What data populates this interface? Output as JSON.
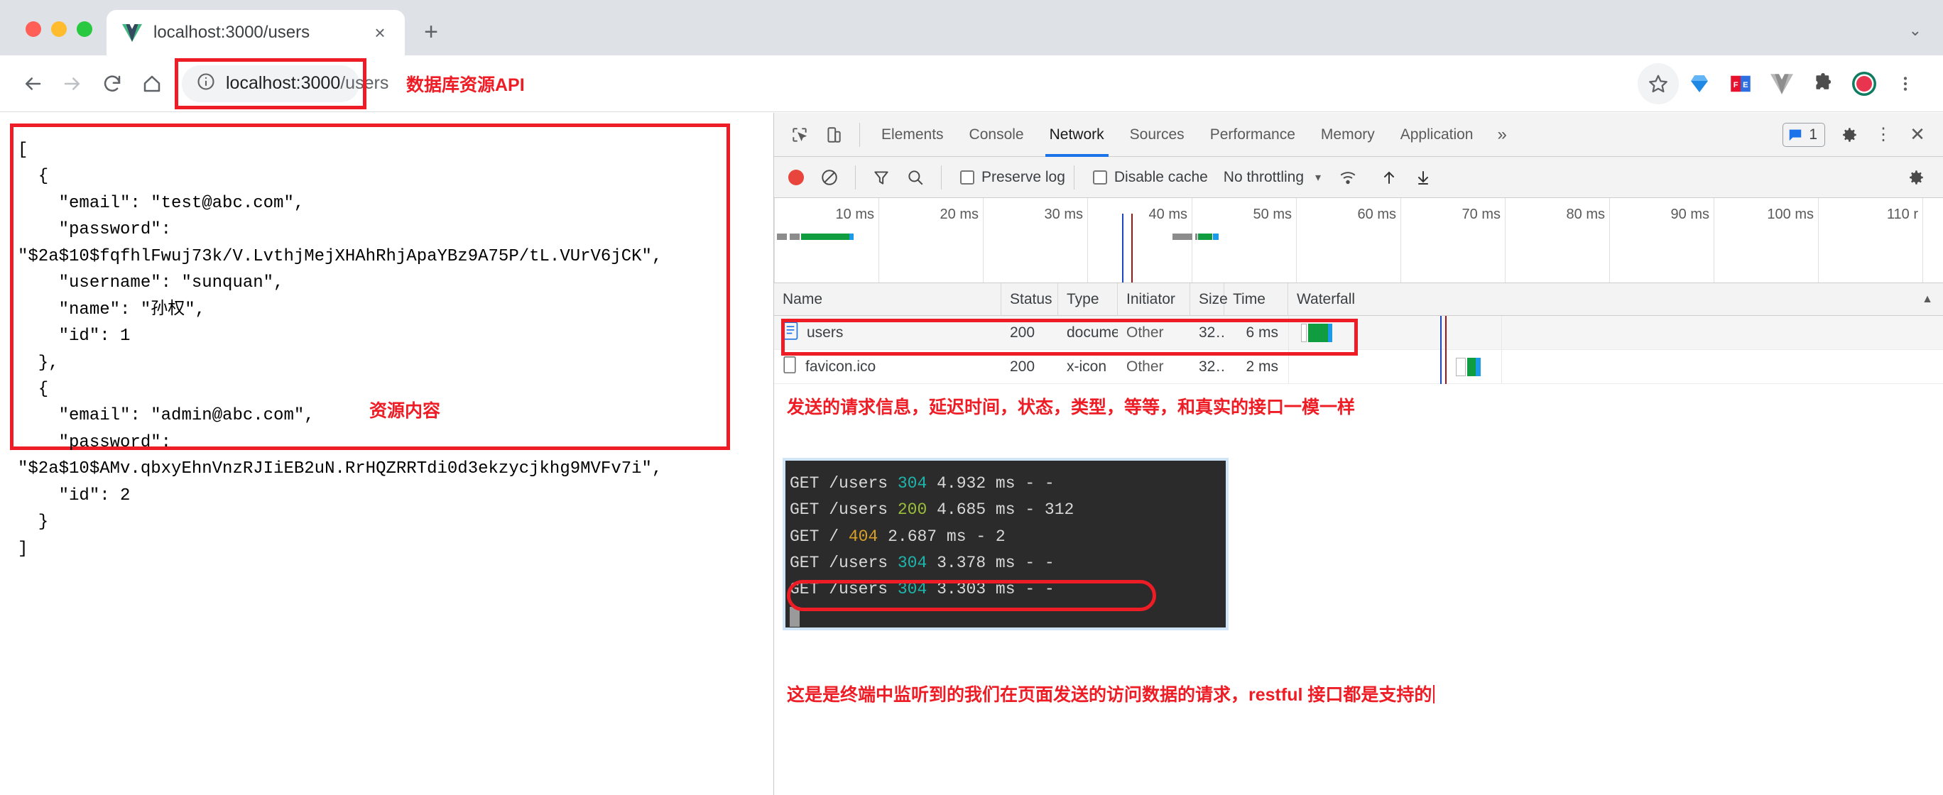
{
  "browser": {
    "tab": {
      "title": "localhost:3000/users",
      "favicon": "vue-logo-icon",
      "close": "×"
    },
    "newtab_label": "+",
    "tabstrip_chevron": "⌄",
    "nav": {
      "back": "←",
      "forward": "→",
      "reload": "↻",
      "home": "⌂"
    },
    "url": {
      "scheme_icon": "info-icon",
      "value": "localhost:3000/users",
      "host": "localhost:3000",
      "path": "/users"
    },
    "annotation_url": "数据库资源API",
    "extensions": [
      {
        "name": "bookmark-star-icon",
        "glyph": "☆"
      },
      {
        "name": "diamond-extension-icon",
        "glyph": "◆"
      },
      {
        "name": "fe-extension-icon",
        "glyph": "FE"
      },
      {
        "name": "vue-devtools-icon",
        "glyph": "V"
      },
      {
        "name": "puzzle-extensions-icon",
        "glyph": "❖"
      },
      {
        "name": "watermelon-extension-icon",
        "glyph": "●"
      },
      {
        "name": "chrome-menu-icon",
        "glyph": "⋮"
      }
    ]
  },
  "page": {
    "json_body": "[\n  {\n    \"email\": \"test@abc.com\",\n    \"password\":\n\"$2a$10$fqfhlFwuj73k/V.LvthjMejXHAhRhjApaYBz9A75P/tL.VUrV6jCK\",\n    \"username\": \"sunquan\",\n    \"name\": \"孙权\",\n    \"id\": 1\n  },\n  {\n    \"email\": \"admin@abc.com\",\n    \"password\":\n\"$2a$10$AMv.qbxyEhnVnzRJIiEB2uN.RrHQZRRTdi0d3ekzycjkhg9MVFv7i\",\n    \"id\": 2\n  }\n]",
    "annotation_resource": "资源内容"
  },
  "devtools": {
    "tabs": [
      {
        "label": "Elements",
        "active": false
      },
      {
        "label": "Console",
        "active": false
      },
      {
        "label": "Network",
        "active": true
      },
      {
        "label": "Sources",
        "active": false
      },
      {
        "label": "Performance",
        "active": false
      },
      {
        "label": "Memory",
        "active": false
      },
      {
        "label": "Application",
        "active": false
      }
    ],
    "more_tabs": "»",
    "message_count": "1",
    "settings_icon": "gear-icon",
    "kebab_icon": "⋮",
    "close_icon": "✕",
    "toolbar": {
      "record_label": "record-button",
      "clear_label": "clear-button",
      "filter_label": "filter-button",
      "search_label": "search-button",
      "preserve_log": "Preserve log",
      "disable_cache": "Disable cache",
      "throttling": "No throttling",
      "caret": "▾",
      "import_label": "import-har-button",
      "export_label": "export-har-button",
      "wifi_label": "network-conditions-icon"
    },
    "timeline_ticks": [
      "10 ms",
      "20 ms",
      "30 ms",
      "40 ms",
      "50 ms",
      "60 ms",
      "70 ms",
      "80 ms",
      "90 ms",
      "100 ms",
      "110 r"
    ],
    "table": {
      "columns": [
        "Name",
        "Status",
        "Type",
        "Initiator",
        "Size",
        "Time",
        "Waterfall"
      ],
      "sort_arrow": "▲",
      "rows": [
        {
          "icon": "document-icon",
          "name": "users",
          "status": "200",
          "type": "document",
          "initiator": "Other",
          "size": "32…",
          "time": "6 ms",
          "highlighted": true
        },
        {
          "icon": "file-icon",
          "name": "favicon.ico",
          "status": "200",
          "type": "x-icon",
          "initiator": "Other",
          "size": "32…",
          "time": "2 ms",
          "highlighted": false
        }
      ]
    },
    "annotation_network": "发送的请求信息，延迟时间，状态，类型，等等，和真实的接口一模一样",
    "terminal": {
      "lines": [
        {
          "method": "GET",
          "path": "/users",
          "status": "304",
          "status_class": "c-304",
          "rest": "4.932 ms - -"
        },
        {
          "method": "GET",
          "path": "/users",
          "status": "200",
          "status_class": "c-200",
          "rest": "4.685 ms - 312"
        },
        {
          "method": "GET",
          "path": "/",
          "status": "404",
          "status_class": "c-404",
          "rest": "2.687 ms - 2"
        },
        {
          "method": "GET",
          "path": "/users",
          "status": "304",
          "status_class": "c-304",
          "rest": "3.378 ms - -"
        },
        {
          "method": "GET",
          "path": "/users",
          "status": "304",
          "status_class": "c-304",
          "rest": "3.303 ms - -"
        }
      ]
    },
    "annotation_terminal": "这是是终端中监听到的我们在页面发送的访问数据的请求，restful 接口都是支持的"
  },
  "colors": {
    "annotation_red": "#ee1c25",
    "accent_blue": "#1a73e8",
    "waterfall_green": "#0f9d40",
    "waterfall_blue": "#1a9ae8",
    "waterfall_gray": "#8c8c8c",
    "terminal_bg": "#2b2b2b"
  }
}
